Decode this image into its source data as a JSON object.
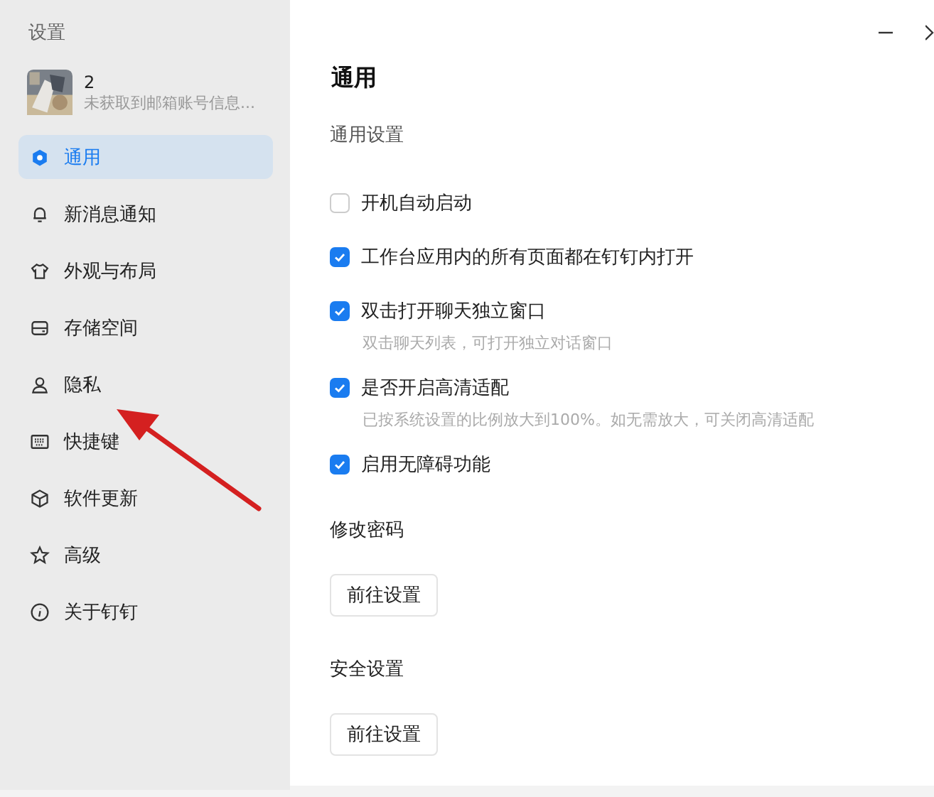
{
  "sidebar": {
    "title": "设置",
    "profile": {
      "name": "2",
      "subtitle": "未获取到邮箱账号信息..."
    },
    "items": [
      {
        "kind": "general",
        "label": "通用",
        "selected": true
      },
      {
        "kind": "bell",
        "label": "新消息通知",
        "selected": false
      },
      {
        "kind": "shirt",
        "label": "外观与布局",
        "selected": false
      },
      {
        "kind": "drive",
        "label": "存储空间",
        "selected": false
      },
      {
        "kind": "person",
        "label": "隐私",
        "selected": false
      },
      {
        "kind": "keyboard",
        "label": "快捷键",
        "selected": false
      },
      {
        "kind": "cube",
        "label": "软件更新",
        "selected": false
      },
      {
        "kind": "star",
        "label": "高级",
        "selected": false
      },
      {
        "kind": "info",
        "label": "关于钉钉",
        "selected": false
      }
    ]
  },
  "main": {
    "heading": "通用",
    "section": "通用设置",
    "options": [
      {
        "label": "开机自动启动",
        "checked": false
      },
      {
        "label": "工作台应用内的所有页面都在钉钉内打开",
        "checked": true
      },
      {
        "label": "双击打开聊天独立窗口",
        "checked": true,
        "hint": "双击聊天列表，可打开独立对话窗口"
      },
      {
        "label": "是否开启高清适配",
        "checked": true,
        "hint": "已按系统设置的比例放大到100%。如无需放大，可关闭高清适配"
      },
      {
        "label": "启用无障碍功能",
        "checked": true
      }
    ],
    "groups": [
      {
        "title": "修改密码",
        "button": "前往设置"
      },
      {
        "title": "安全设置",
        "button": "前往设置"
      }
    ]
  }
}
